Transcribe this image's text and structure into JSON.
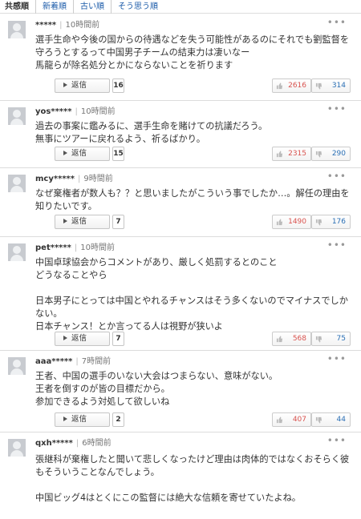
{
  "tabs": [
    "共感順",
    "新着順",
    "古い順",
    "そう思う順"
  ],
  "reply_label": "返信",
  "more_label": "•••",
  "comments": [
    {
      "user": "*****",
      "time": "10時間前",
      "text": "選手生命や今後の国からの待遇などを失う可能性があるのにそれでも劉監督を守ろうとするって中国男子チームの結束力は凄いなー\n馬龍らが除名処分とかにならないことを祈ります",
      "replies": "16",
      "likes": "2616",
      "dislikes": "314"
    },
    {
      "user": "yos*****",
      "time": "10時間前",
      "text": "過去の事案に鑑みるに、選手生命を賭けての抗議だろう。\n無事にツアーに戻れるよう、祈るばかり。",
      "replies": "15",
      "likes": "2315",
      "dislikes": "290"
    },
    {
      "user": "mcy*****",
      "time": "9時間前",
      "text": "なぜ棄権者が数人も？？と思いましたがこういう事でしたか…。解任の理由を知りたいです。",
      "replies": "7",
      "likes": "1490",
      "dislikes": "176"
    },
    {
      "user": "pet*****",
      "time": "10時間前",
      "text": "中国卓球協会からコメントがあり、厳しく処罰するとのこと\nどうなることやら\n\n日本男子にとっては中国とやれるチャンスはそう多くないのでマイナスでしかない。\n日本チャンス！とか言ってる人は視野が狭いよ",
      "replies": "7",
      "likes": "568",
      "dislikes": "75"
    },
    {
      "user": "aaa*****",
      "time": "7時間前",
      "text": "王者、中国の選手のいない大会はつまらない、意味がない。\n王者を倒すのが皆の目標だから。\n参加できるよう対処して欲しいね",
      "replies": "2",
      "likes": "407",
      "dislikes": "44"
    },
    {
      "user": "qxh*****",
      "time": "6時間前",
      "text": "張継科が棄権したと聞いて悲しくなったけど理由は肉体的ではなくおそらく彼もそういうことなんでしょう。\n\n中国ビッグ4はとくにこの監督には絶大な信頼を寄せていたよね。",
      "replies": "",
      "likes": "",
      "dislikes": ""
    }
  ]
}
